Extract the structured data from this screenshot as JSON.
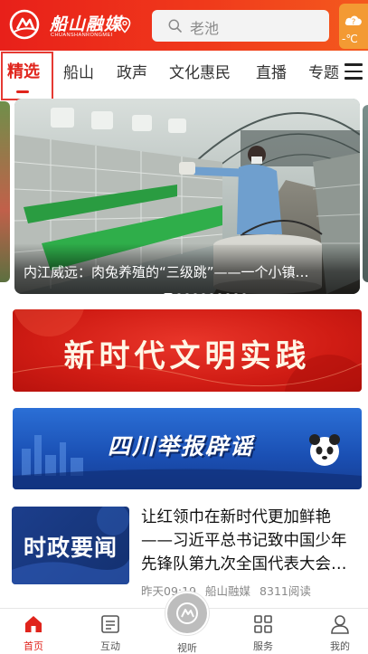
{
  "header": {
    "brand_name": "船山融媒",
    "brand_sub": "CHUANSHANRONGMEI",
    "search_placeholder": "老池",
    "weather_temp": "-℃",
    "icons": [
      "location-pin-icon",
      "search-icon",
      "weather-icon"
    ]
  },
  "tabs": {
    "items": [
      {
        "label": "精选",
        "active": true
      },
      {
        "label": "船山"
      },
      {
        "label": "政声"
      },
      {
        "label": "文化惠民"
      },
      {
        "label": "直播"
      },
      {
        "label": "专题"
      }
    ],
    "menu_icon": "hamburger-menu-icon"
  },
  "carousel": {
    "caption": "内江威远：肉兔养殖的“三级跳”——一个小镇…",
    "slide_count": 10,
    "active_index": 0
  },
  "promos": {
    "red_banner": "新时代文明实践",
    "blue_banner": "四川举报辟谣"
  },
  "news": {
    "thumb_text": "时政要闻",
    "title": "让红领巾在新时代更加鲜艳——习近平总书记致中国少年先锋队第九次全国代表大会…",
    "time": "昨天09:19",
    "source": "船山融媒",
    "reads": "8311阅读"
  },
  "bottom_nav": {
    "items": [
      {
        "label": "首页",
        "icon": "home-icon",
        "active": true
      },
      {
        "label": "互动",
        "icon": "interaction-icon"
      },
      {
        "label": "视听",
        "icon": "video-logo-icon"
      },
      {
        "label": "服务",
        "icon": "grid-services-icon"
      },
      {
        "label": "我的",
        "icon": "profile-icon"
      }
    ]
  },
  "colors": {
    "brand_red": "#e0241c",
    "weather_orange": "#f39a33",
    "promo_blue": "#1a4fb3"
  }
}
